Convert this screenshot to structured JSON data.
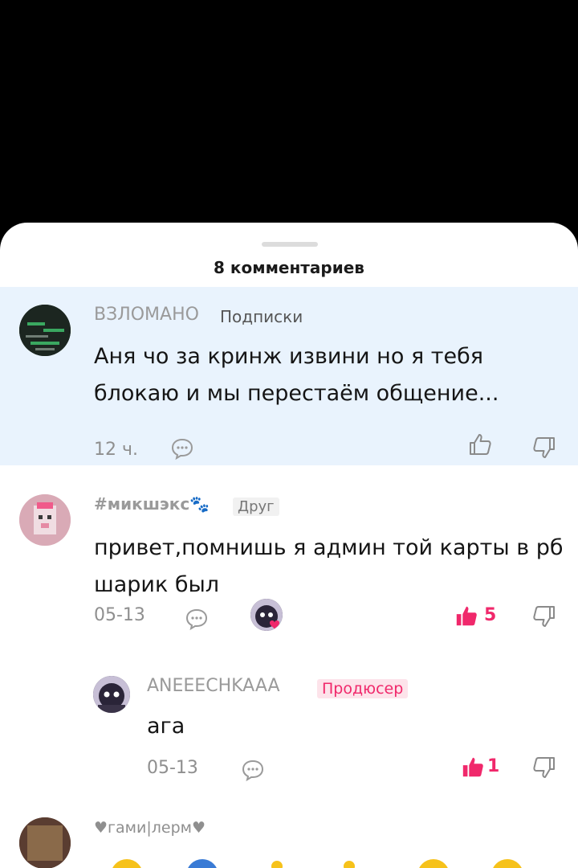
{
  "header": {
    "title": "8 комментариев"
  },
  "comments": [
    {
      "user": "ВЗЛОМАНО",
      "tag": "Подписки",
      "text": "Аня чо за кринж извини но я тебя блокаю и мы перестаём общение...",
      "time": "12 ч."
    },
    {
      "user": "#микшэкс🐾",
      "tag": "Друг",
      "text": "привет,помнишь я админ той карты в рб шарик был",
      "time": "05-13",
      "likes": "5"
    },
    {
      "user": "ANEEECHKAAA",
      "tag": "Продюсер",
      "text": "ага",
      "time": "05-13",
      "likes": "1"
    },
    {
      "user": "♥гами|лерм♥"
    }
  ],
  "colors": {
    "accent": "#f0286b",
    "highlight": "#e9f3fd"
  },
  "icons": [
    "reply-icon",
    "like-icon",
    "dislike-icon",
    "liked-icon"
  ]
}
